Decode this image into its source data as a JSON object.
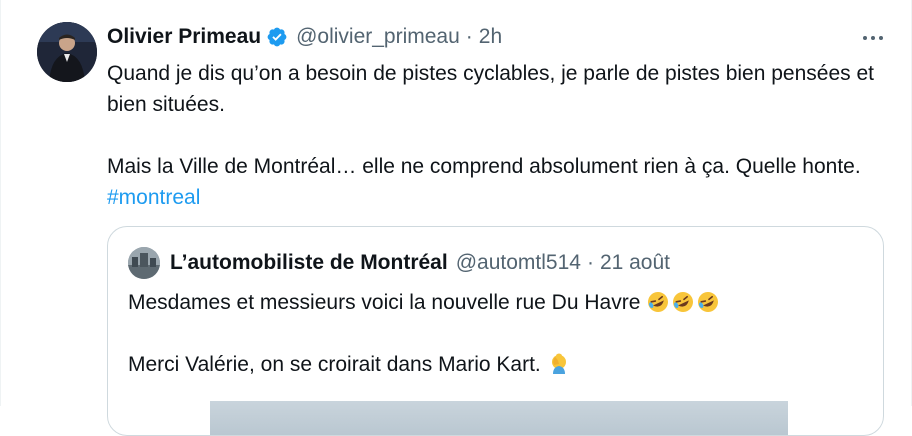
{
  "tweet": {
    "author_name": "Olivier Primeau",
    "handle": "@olivier_primeau",
    "separator": "·",
    "time": "2h",
    "text_line1": "Quand je dis qu’on a besoin de pistes cyclables, je parle de pistes bien pensées et bien situées.",
    "text_line2": "Mais la Ville de Montréal… elle ne comprend absolument rien à ça. Quelle honte. ",
    "hashtag": "#montreal",
    "verified_icon": "verified-badge-icon",
    "more_icon": "more-options-icon"
  },
  "quote": {
    "author_name": "L’automobiliste de Montréal",
    "handle": "@automtl514",
    "separator": "·",
    "date": "21 août",
    "text_line1": "Mesdames et messieurs voici la nouvelle rue Du Havre ",
    "text_line2": "Merci Valérie, on se croirait dans Mario Kart. ",
    "emojis_line1": [
      "rolling-laughing-emoji",
      "rolling-laughing-emoji",
      "rolling-laughing-emoji"
    ],
    "emoji_line2": "facepalm-emoji"
  },
  "colors": {
    "text": "#0f1419",
    "secondary": "#536471",
    "link": "#1d9bf0",
    "border": "#cfd9de"
  }
}
